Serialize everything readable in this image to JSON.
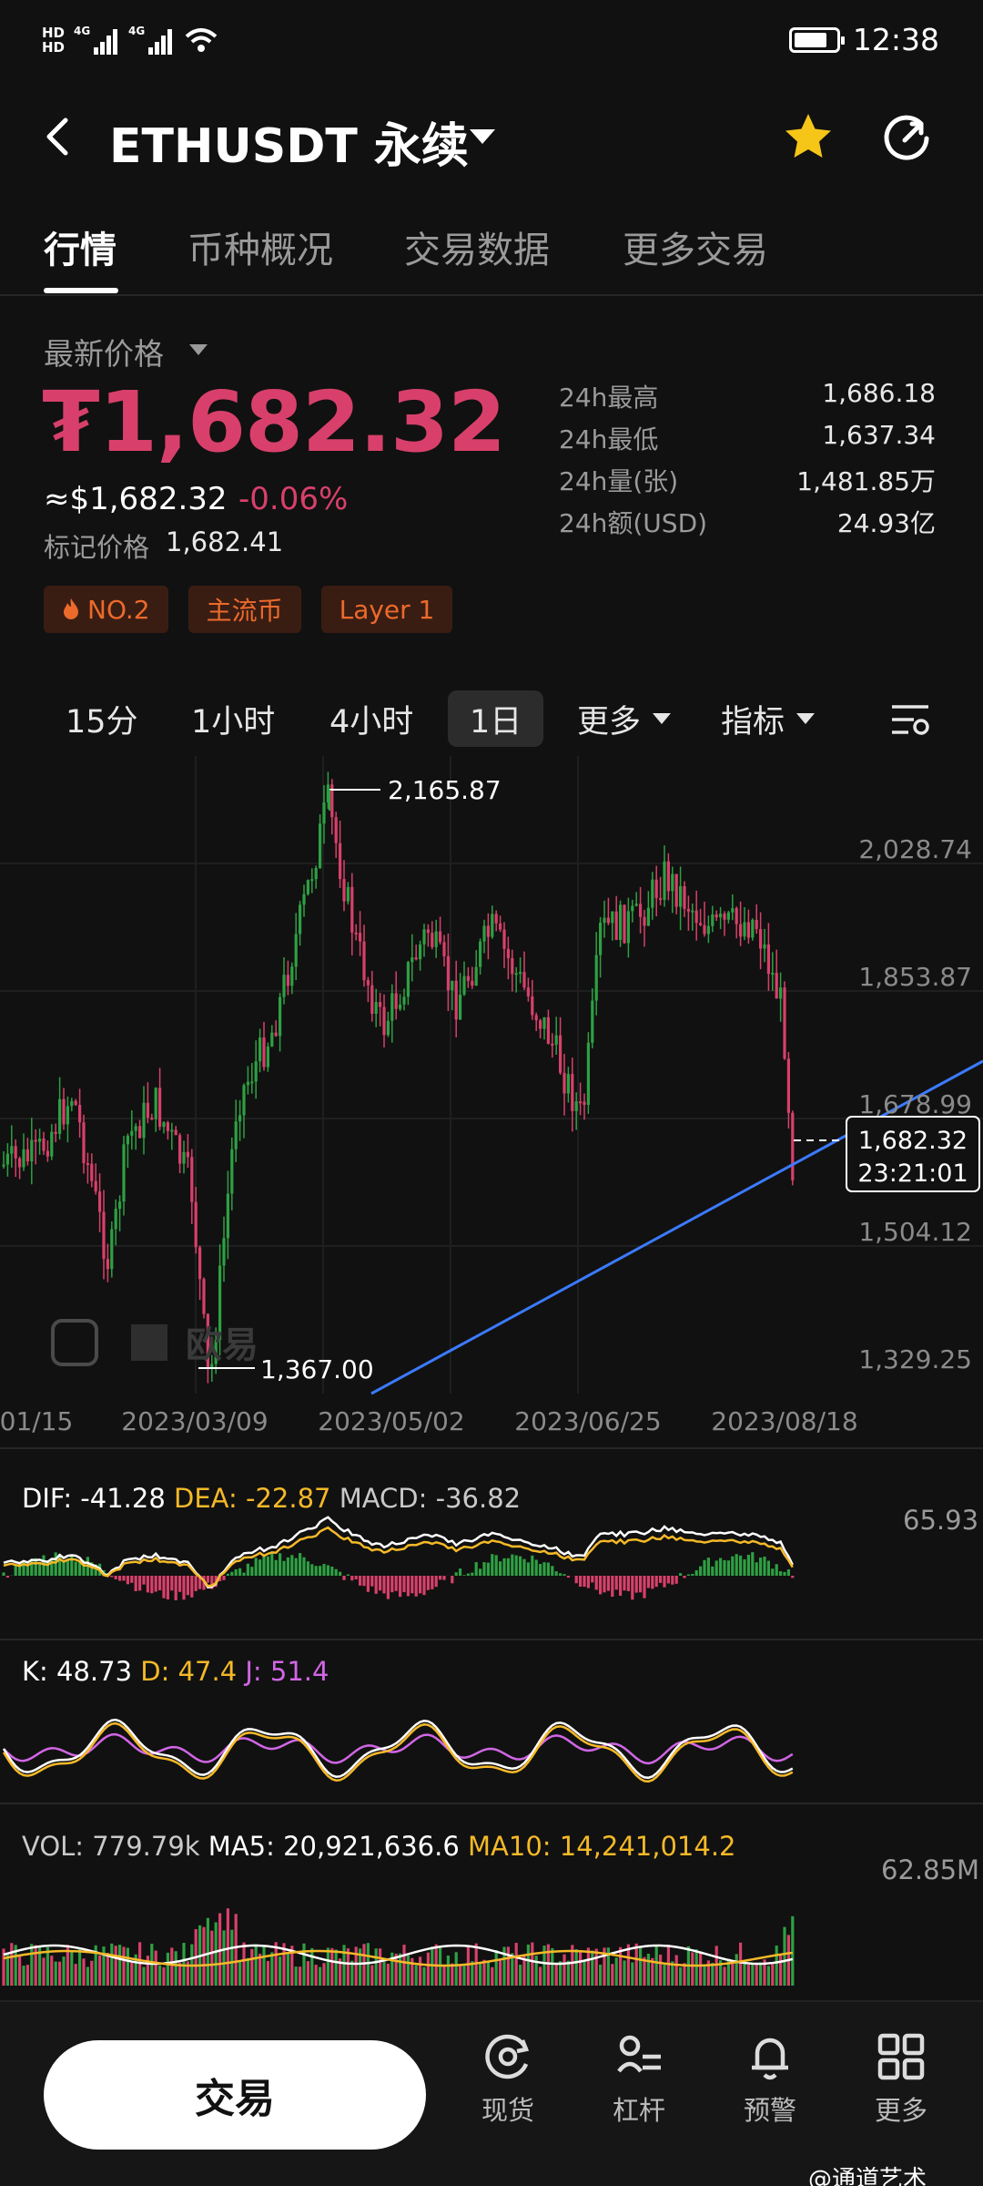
{
  "status_bar": {
    "time": "12:38",
    "net1": "4G",
    "net2": "4G",
    "hd1": "HD",
    "hd2": "HD"
  },
  "header": {
    "title": "ETHUSDT 永续"
  },
  "tabs": [
    {
      "label": "行情",
      "active": true
    },
    {
      "label": "币种概况"
    },
    {
      "label": "交易数据"
    },
    {
      "label": "更多交易"
    }
  ],
  "price": {
    "label": "最新价格",
    "last": "₮1,682.32",
    "usd": "≈$1,682.32",
    "change": "-0.06%",
    "mark_label": "标记价格",
    "mark_value": "1,682.41"
  },
  "stats": [
    {
      "label": "24h最高",
      "value": "1,686.18"
    },
    {
      "label": "24h最低",
      "value": "1,637.34"
    },
    {
      "label": "24h量(张)",
      "value": "1,481.85万"
    },
    {
      "label": "24h额(USD)",
      "value": "24.93亿"
    }
  ],
  "tags": [
    "NO.2",
    "主流币",
    "Layer 1"
  ],
  "timeframes": [
    {
      "label": "15分"
    },
    {
      "label": "1小时"
    },
    {
      "label": "4小时"
    },
    {
      "label": "1日",
      "active": true
    },
    {
      "label": "更多",
      "dropdown": true
    },
    {
      "label": "指标",
      "dropdown": true
    }
  ],
  "main_chart": {
    "y_ticks": [
      "2,028.74",
      "1,853.87",
      "1,678.99",
      "1,504.12",
      "1,329.25"
    ],
    "x_ticks": [
      "01/15",
      "2023/03/09",
      "2023/05/02",
      "2023/06/25",
      "2023/08/18"
    ],
    "high_label": "2,165.87",
    "low_label": "1,367.00",
    "current_price": "1,682.32",
    "countdown": "23:21:01",
    "watermark": "欧易"
  },
  "macd": {
    "dif": "DIF: -41.28",
    "dea": "DEA: -22.87",
    "macd": "MACD: -36.82",
    "scale": "65.93"
  },
  "kdj": {
    "k": "K: 48.73",
    "d": "D: 47.4",
    "j": "J: 51.4"
  },
  "volume": {
    "vol": "VOL: 779.79k",
    "ma5": "MA5: 20,921,636.6",
    "ma10": "MA10: 14,241,014.2",
    "scale": "62.85M"
  },
  "bottom_nav": {
    "trade": "交易",
    "items": [
      {
        "label": "现货",
        "icon": "spot-icon"
      },
      {
        "label": "杠杆",
        "icon": "margin-icon"
      },
      {
        "label": "预警",
        "icon": "bell-icon"
      },
      {
        "label": "更多",
        "icon": "grid-icon"
      }
    ]
  },
  "watermark": "@通道艺术",
  "colors": {
    "up": "#2ea043",
    "down": "#d8406b",
    "accent": "#f5c518",
    "trend": "#3b7bff"
  }
}
